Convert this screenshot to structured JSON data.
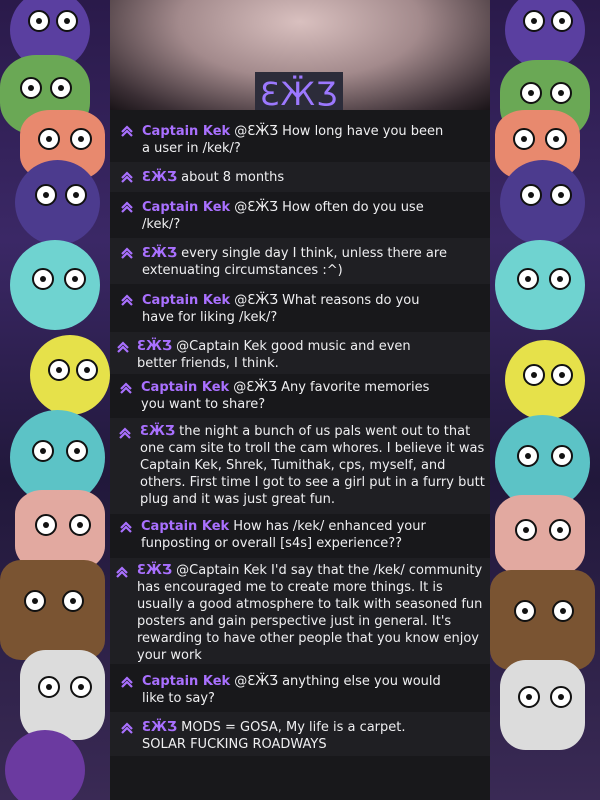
{
  "header": {
    "logo_text": "ƐӜƷ"
  },
  "messages": [
    {
      "user": "Captain Kek",
      "text": "@ƐӜƷ How long have you been a user in /kek/?"
    },
    {
      "user": "ƐӜƷ",
      "text": "about 8 months"
    },
    {
      "user": "Captain Kek",
      "text": "@ƐӜƷ How often do you use /kek/?"
    },
    {
      "user": "ƐӜƷ",
      "text": "every single day I think, unless there are extenuating circumstances :^)"
    },
    {
      "user": "Captain Kek",
      "text": "@ƐӜƷ What reasons do you have for liking /kek/?"
    },
    {
      "user": "ƐӜƷ",
      "text": "@Captain Kek good music and even better friends, I think."
    },
    {
      "user": "Captain Kek",
      "text": "@ƐӜƷ Any favorite memories you want to share?"
    },
    {
      "user": "ƐӜƷ",
      "text": "the night a bunch of us pals went out to that one cam site to troll the cam whores. I believe it was Captain Kek, Shrek, Tumithak, cps, myself, and others. First time I got to see a girl put in a furry butt plug and it was just great fun."
    },
    {
      "user": "Captain Kek",
      "text": "How has /kek/ enhanced your funposting or overall [s4s] experience??"
    },
    {
      "user": "ƐӜƷ",
      "text": "@Captain Kek I'd say that the /kek/ community has encouraged me to create more things. It is usually a good atmosphere to talk with seasoned fun posters and gain perspective just in general. It's rewarding to have other people that you know enjoy your work"
    },
    {
      "user": "Captain Kek",
      "text": "@ƐӜƷ anything else you would like to say?"
    },
    {
      "user": "ƐӜƷ",
      "text": "MODS = GOSA, My life is a carpet. SOLAR FUCKING ROADWAYS"
    }
  ],
  "colors": {
    "username": "#a970ff",
    "text": "#efeff1",
    "panel": "#18181b",
    "panel_alt": "#1f1f23"
  },
  "icons": {
    "badge": "chevron-up-badge-icon"
  }
}
